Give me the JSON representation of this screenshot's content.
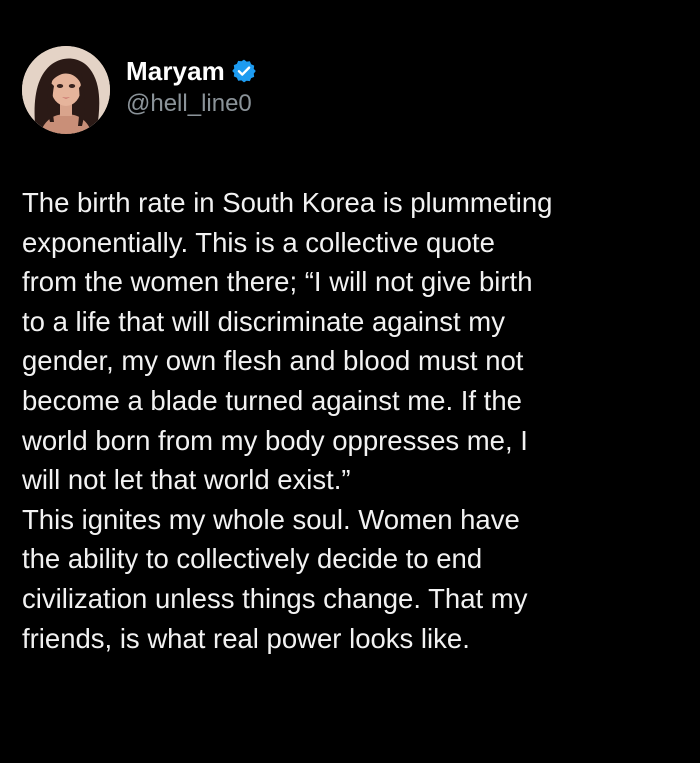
{
  "user": {
    "display_name": "Maryam",
    "handle": "@hell_line0",
    "verified_icon": "verified-badge-icon",
    "avatar_icon": "avatar-illustration",
    "accent_color": "#1d9bf0"
  },
  "tweet": {
    "lines": [
      "The birth rate in South Korea is plummeting",
      "exponentially. This is a collective quote",
      "from the women there; “I will not give birth",
      "to a life that will discriminate against my",
      "gender, my own flesh and blood must not",
      "become a blade turned against me. If the",
      "world born from my body oppresses me, I",
      "will not let that world exist.”",
      "This ignites my whole soul. Women have",
      "the ability to collectively decide to end",
      "civilization unless things change. That my",
      "friends, is what real power looks like."
    ]
  }
}
